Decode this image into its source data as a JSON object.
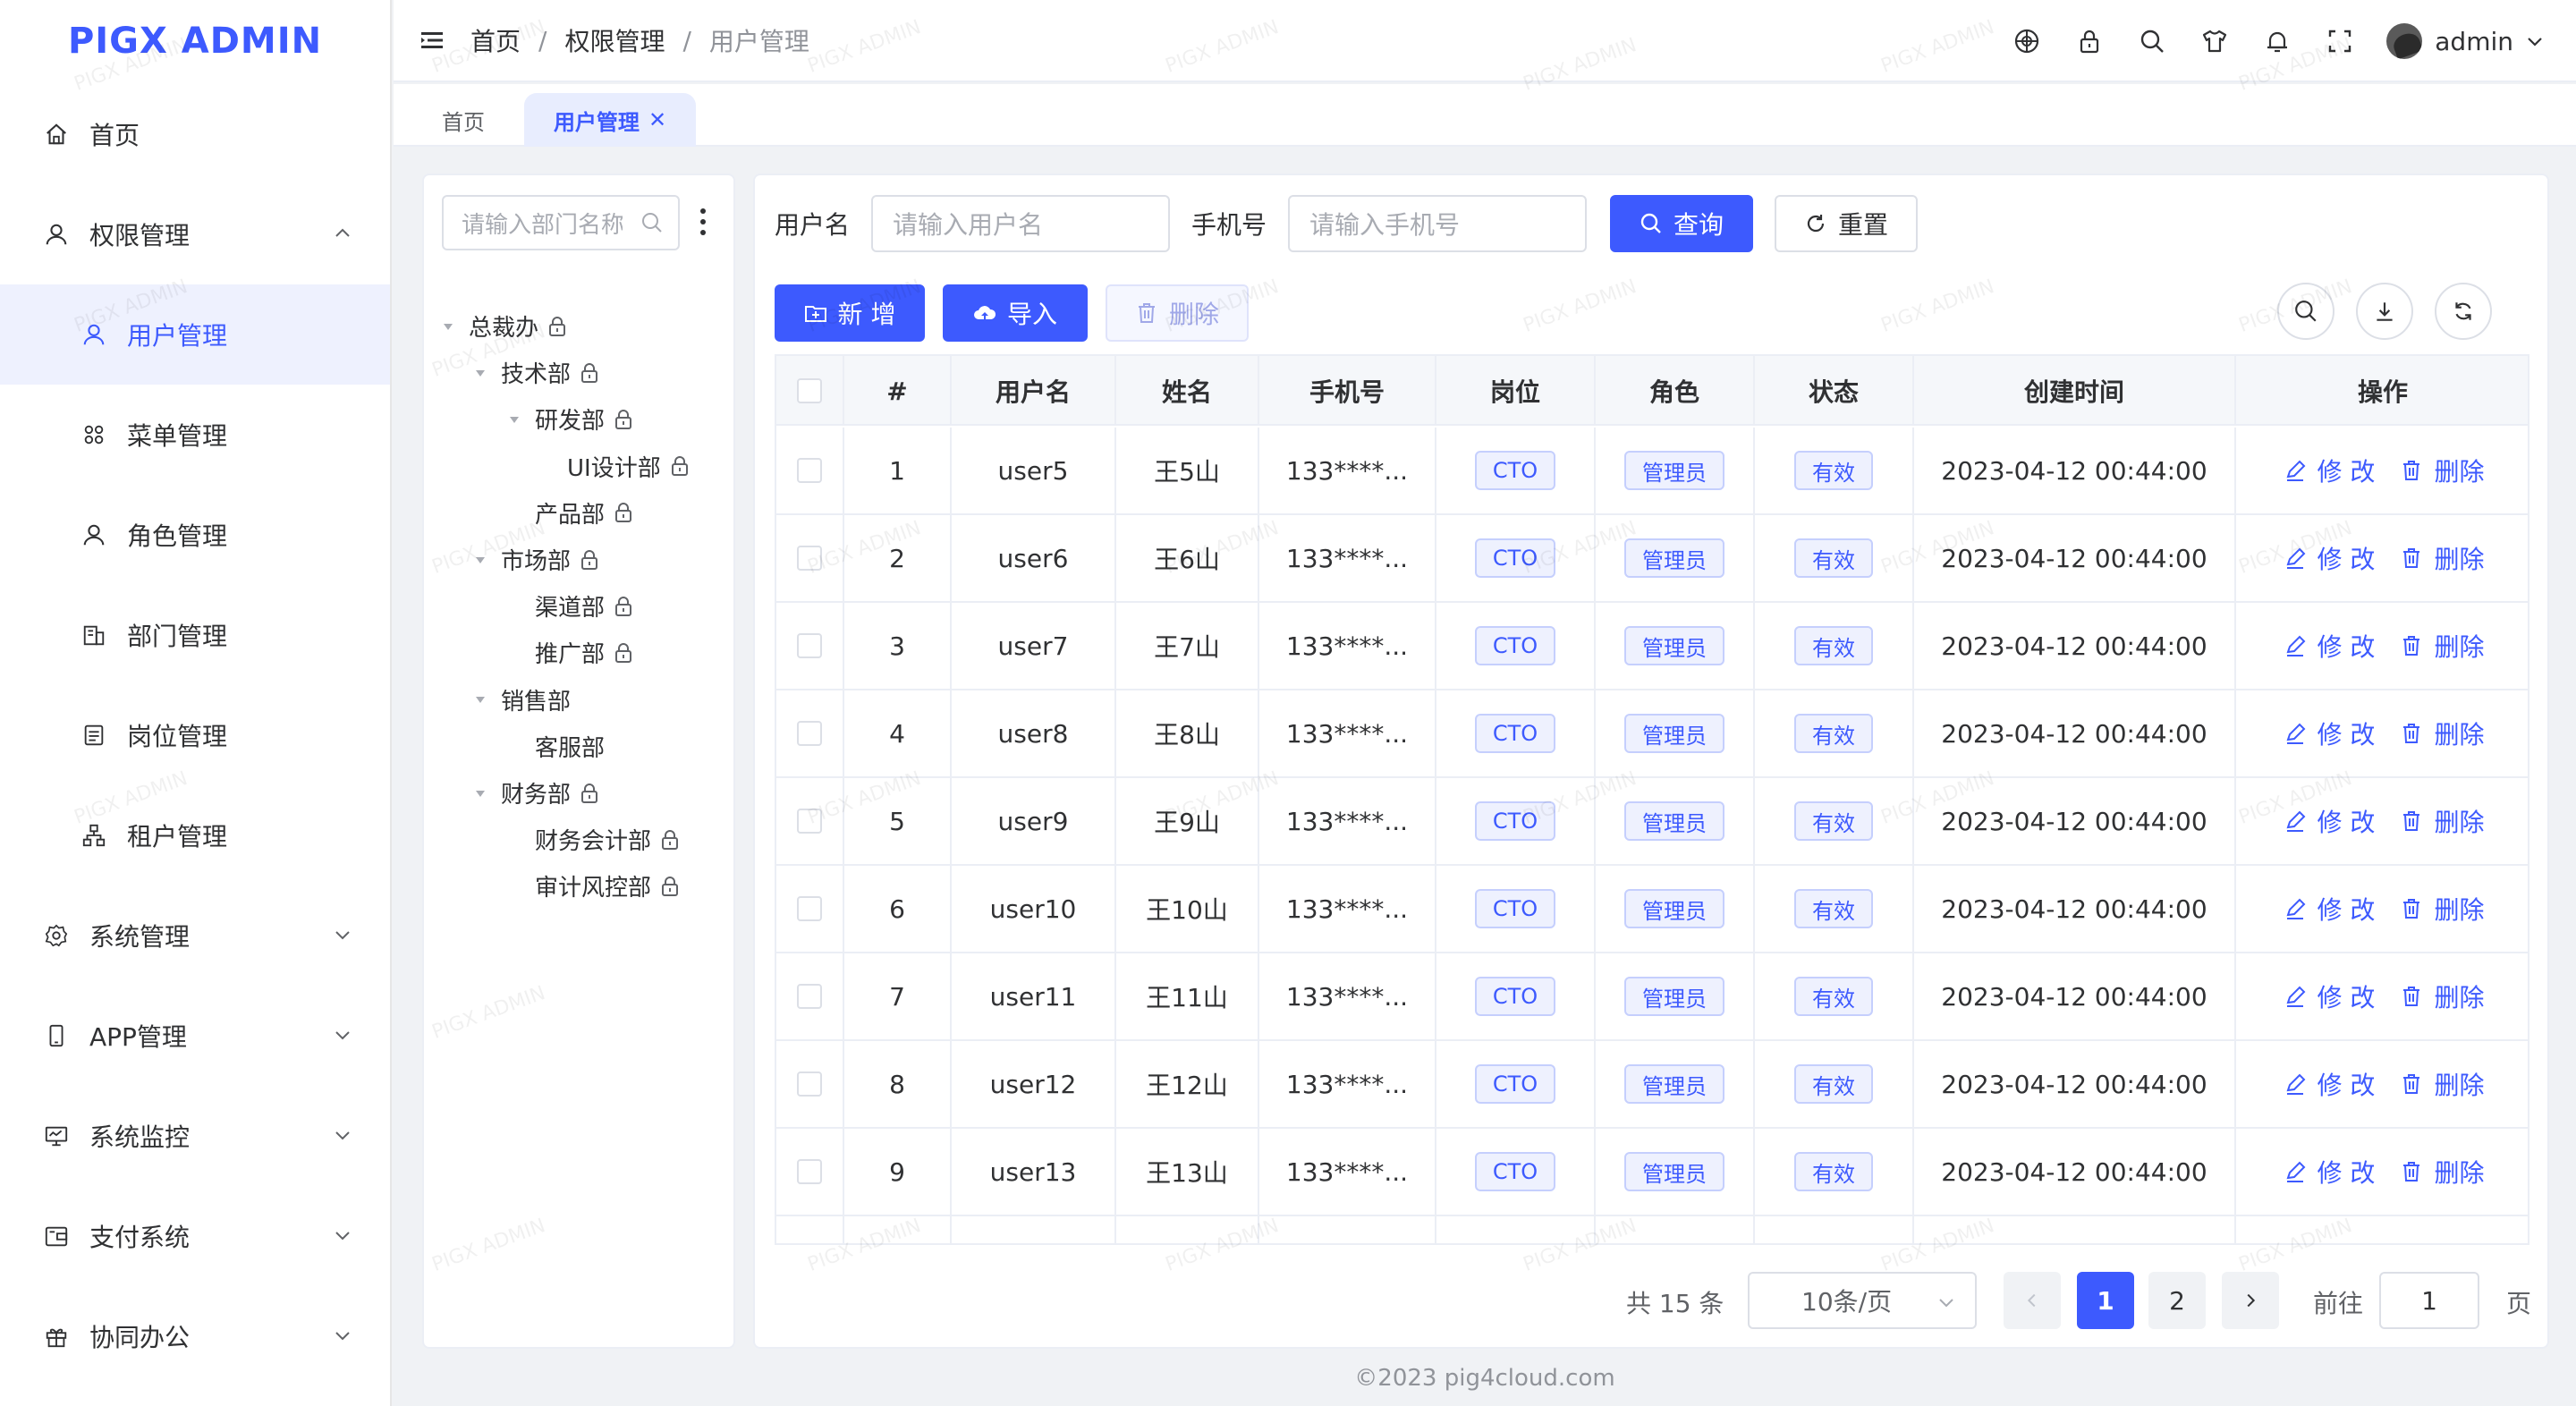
{
  "app": {
    "logo": "PIGX ADMIN",
    "footer": "©2023 pig4cloud.com",
    "watermark": "PIGX ADMIN",
    "accent": "#3d5afe"
  },
  "sidebar": {
    "items": [
      {
        "label": "首页",
        "icon": "home-icon",
        "level": 1,
        "expandable": false
      },
      {
        "label": "权限管理",
        "icon": "user-icon",
        "level": 1,
        "expandable": true,
        "expanded": true
      },
      {
        "label": "用户管理",
        "icon": "user-icon",
        "level": 2,
        "active": true
      },
      {
        "label": "菜单管理",
        "icon": "grid-icon",
        "level": 2
      },
      {
        "label": "角色管理",
        "icon": "user-icon",
        "level": 2
      },
      {
        "label": "部门管理",
        "icon": "building-icon",
        "level": 2
      },
      {
        "label": "岗位管理",
        "icon": "list-icon",
        "level": 2
      },
      {
        "label": "租户管理",
        "icon": "org-icon",
        "level": 2
      },
      {
        "label": "系统管理",
        "icon": "gear-icon",
        "level": 1,
        "expandable": true
      },
      {
        "label": "APP管理",
        "icon": "phone-icon",
        "level": 1,
        "expandable": true
      },
      {
        "label": "系统监控",
        "icon": "monitor-icon",
        "level": 1,
        "expandable": true
      },
      {
        "label": "支付系统",
        "icon": "wallet-icon",
        "level": 1,
        "expandable": true
      },
      {
        "label": "协同办公",
        "icon": "gift-icon",
        "level": 1,
        "expandable": true
      }
    ]
  },
  "header": {
    "breadcrumb": [
      "首页",
      "权限管理",
      "用户管理"
    ],
    "tools": [
      "globe-icon",
      "lock-icon",
      "search-icon",
      "shirt-icon",
      "bell-icon",
      "fullscreen-icon"
    ],
    "user": "admin"
  },
  "tabs": [
    {
      "label": "首页",
      "active": false
    },
    {
      "label": "用户管理",
      "active": true,
      "closable": true
    }
  ],
  "dept_tree": {
    "search_placeholder": "请输入部门名称",
    "nodes": [
      {
        "label": "总裁办",
        "depth": 0,
        "caret": true,
        "lock": true
      },
      {
        "label": "技术部",
        "depth": 1,
        "caret": true,
        "lock": true
      },
      {
        "label": "研发部",
        "depth": 2,
        "caret": true,
        "lock": true
      },
      {
        "label": "UI设计部",
        "depth": 3,
        "caret": false,
        "lock": true
      },
      {
        "label": "产品部",
        "depth": 2,
        "caret": false,
        "lock": true
      },
      {
        "label": "市场部",
        "depth": 1,
        "caret": true,
        "lock": true
      },
      {
        "label": "渠道部",
        "depth": 2,
        "caret": false,
        "lock": true
      },
      {
        "label": "推广部",
        "depth": 2,
        "caret": false,
        "lock": true
      },
      {
        "label": "销售部",
        "depth": 1,
        "caret": true,
        "lock": false
      },
      {
        "label": "客服部",
        "depth": 2,
        "caret": false,
        "lock": false
      },
      {
        "label": "财务部",
        "depth": 1,
        "caret": true,
        "lock": true
      },
      {
        "label": "财务会计部",
        "depth": 2,
        "caret": false,
        "lock": true
      },
      {
        "label": "审计风控部",
        "depth": 2,
        "caret": false,
        "lock": true
      }
    ]
  },
  "filters": {
    "username_label": "用户名",
    "username_placeholder": "请输入用户名",
    "phone_label": "手机号",
    "phone_placeholder": "请输入手机号",
    "query_label": "查询",
    "reset_label": "重置"
  },
  "toolbar": {
    "add_label": "新 增",
    "import_label": "导入",
    "delete_label": "删除"
  },
  "table": {
    "columns": [
      "#",
      "用户名",
      "姓名",
      "手机号",
      "岗位",
      "角色",
      "状态",
      "创建时间",
      "操作"
    ],
    "rows": [
      {
        "idx": "1",
        "username": "user5",
        "name": "王5山",
        "phone": "133****...",
        "post": "CTO",
        "role": "管理员",
        "status": "有效",
        "created": "2023-04-12 00:44:00"
      },
      {
        "idx": "2",
        "username": "user6",
        "name": "王6山",
        "phone": "133****...",
        "post": "CTO",
        "role": "管理员",
        "status": "有效",
        "created": "2023-04-12 00:44:00"
      },
      {
        "idx": "3",
        "username": "user7",
        "name": "王7山",
        "phone": "133****...",
        "post": "CTO",
        "role": "管理员",
        "status": "有效",
        "created": "2023-04-12 00:44:00"
      },
      {
        "idx": "4",
        "username": "user8",
        "name": "王8山",
        "phone": "133****...",
        "post": "CTO",
        "role": "管理员",
        "status": "有效",
        "created": "2023-04-12 00:44:00"
      },
      {
        "idx": "5",
        "username": "user9",
        "name": "王9山",
        "phone": "133****...",
        "post": "CTO",
        "role": "管理员",
        "status": "有效",
        "created": "2023-04-12 00:44:00"
      },
      {
        "idx": "6",
        "username": "user10",
        "name": "王10山",
        "phone": "133****...",
        "post": "CTO",
        "role": "管理员",
        "status": "有效",
        "created": "2023-04-12 00:44:00"
      },
      {
        "idx": "7",
        "username": "user11",
        "name": "王11山",
        "phone": "133****...",
        "post": "CTO",
        "role": "管理员",
        "status": "有效",
        "created": "2023-04-12 00:44:00"
      },
      {
        "idx": "8",
        "username": "user12",
        "name": "王12山",
        "phone": "133****...",
        "post": "CTO",
        "role": "管理员",
        "status": "有效",
        "created": "2023-04-12 00:44:00"
      },
      {
        "idx": "9",
        "username": "user13",
        "name": "王13山",
        "phone": "133****...",
        "post": "CTO",
        "role": "管理员",
        "status": "有效",
        "created": "2023-04-12 00:44:00"
      }
    ],
    "edit_label": "修 改",
    "delete_label": "删除"
  },
  "pagination": {
    "total_text": "共 15 条",
    "page_size": "10条/页",
    "pages": [
      "1",
      "2"
    ],
    "current": "1",
    "goto_label": "前往",
    "goto_value": "1",
    "page_suffix": "页"
  }
}
